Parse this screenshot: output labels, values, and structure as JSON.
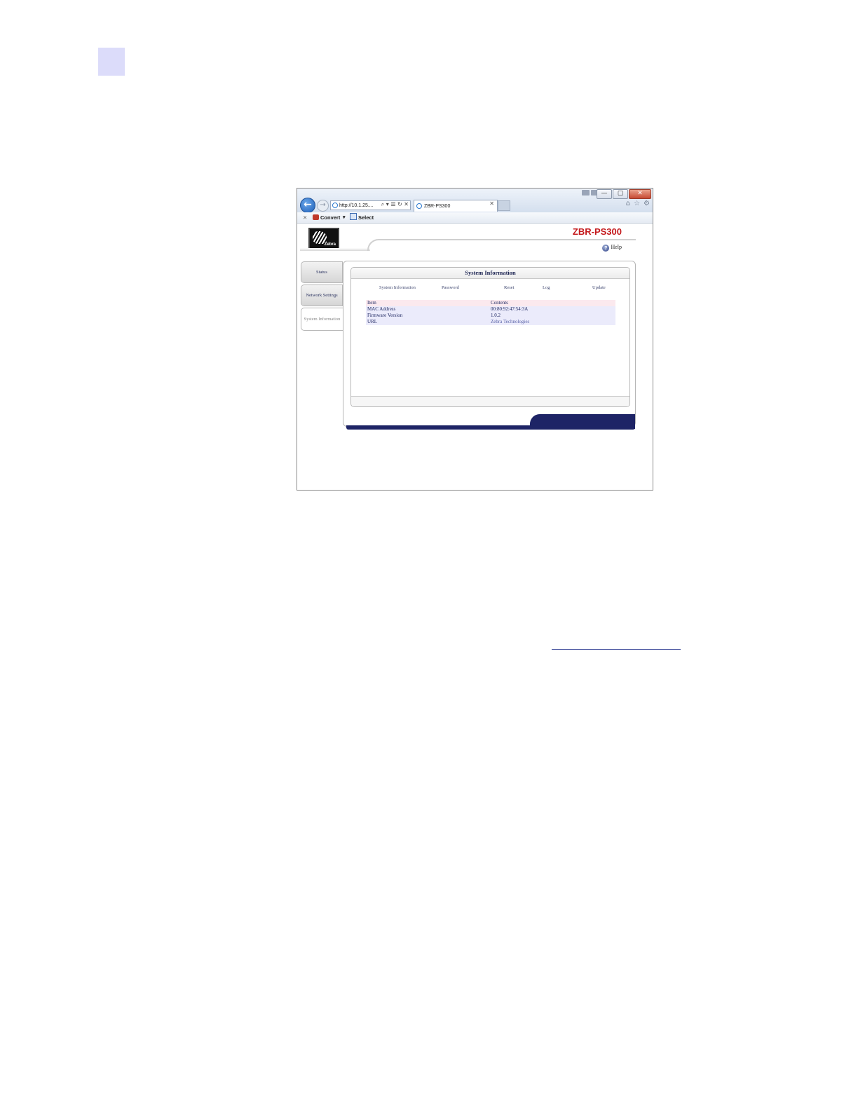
{
  "browser": {
    "address": "http://10.1.25....",
    "address_tools": "⌕ ▾ ☰ ↻ ✕",
    "tab_title": "ZBR-PS300",
    "tab_close": "✕",
    "back_icon": "←",
    "forward_icon": "→",
    "window_controls": {
      "minimize": "—",
      "maximize": "▢",
      "close": "✕"
    },
    "toolbar_icons": {
      "home": "⌂",
      "favorites": "☆",
      "settings": "⚙"
    }
  },
  "command_bar": {
    "close": "✕",
    "convert_label": "Convert",
    "convert_dropdown": "▾",
    "select_label": "Select"
  },
  "header": {
    "logo_text": "Zebra",
    "brand_title": "ZBR-PS300",
    "help_icon": "?",
    "help_label": "Help"
  },
  "side_tabs": [
    {
      "label": "Status"
    },
    {
      "label": "Network Settings"
    },
    {
      "label": "System Information"
    }
  ],
  "panel": {
    "title": "System Information",
    "subnav": [
      "System Information",
      "Password",
      "Reset",
      "Log",
      "Update"
    ]
  },
  "table": {
    "headers": [
      "Item",
      "Contents"
    ],
    "rows": [
      [
        "MAC Address",
        "00:80:92:47:54:3A"
      ],
      [
        "Firmware Version",
        "1.0.2"
      ],
      [
        "URL",
        "Zebra Technologies"
      ]
    ]
  },
  "colors": {
    "brand_red": "#c4181b",
    "footer_navy": "#1e2466",
    "header_row": "#fbe9ee",
    "data_row": "#ebebfb",
    "page_marker": "#dcdcfa"
  }
}
